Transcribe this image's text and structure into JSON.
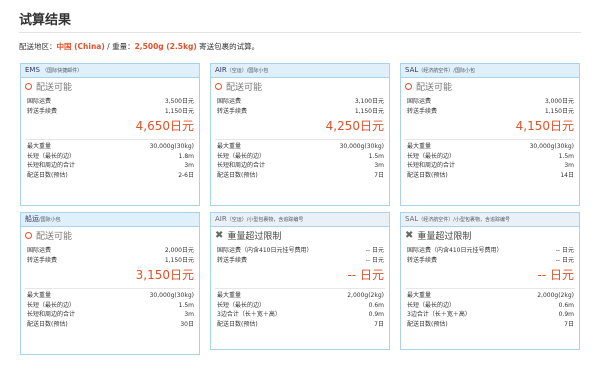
{
  "page_title": "试算结果",
  "summary": {
    "prefix": "配送地区：",
    "region": "中国 (China)",
    "sep": " / 重量：",
    "weight": "2,500g (2.5kg)",
    "suffix": " 寄送包裹的试算。"
  },
  "cards": [
    {
      "head_main": "EMS",
      "head_sub": "（国际快捷邮件）",
      "status": "配送可能",
      "fee1_label": "国际运费",
      "fee1_value": "3,500日元",
      "fee2_label": "转送手续费",
      "fee2_value": "1,150日元",
      "total": "4,650日元",
      "d1_label": "最大重量",
      "d1_value": "30,000g(30kg)",
      "d2_label": "长短（最长的边）",
      "d2_value": "1.8m",
      "d3_label": "长短和周边的合计",
      "d3_value": "3m",
      "d4_label": "配送日数(预估)",
      "d4_value": "2-6日"
    },
    {
      "head_main": "AIR",
      "head_sub": "（空运）/国际小包",
      "status": "配送可能",
      "fee1_label": "国际运费",
      "fee1_value": "3,100日元",
      "fee2_label": "转送手续费",
      "fee2_value": "1,150日元",
      "total": "4,250日元",
      "d1_label": "最大重量",
      "d1_value": "30,000g(30kg)",
      "d2_label": "长短（最长的边）",
      "d2_value": "1.5m",
      "d3_label": "长短和周边的合计",
      "d3_value": "3m",
      "d4_label": "配送日数(预估)",
      "d4_value": "7日"
    },
    {
      "head_main": "SAL",
      "head_sub": "（经济航空件）/国际小包",
      "status": "配送可能",
      "fee1_label": "国际运费",
      "fee1_value": "3,000日元",
      "fee2_label": "转送手续费",
      "fee2_value": "1,150日元",
      "total": "4,150日元",
      "d1_label": "最大重量",
      "d1_value": "30,000g(30kg)",
      "d2_label": "长短（最长的边）",
      "d2_value": "1.5m",
      "d3_label": "长短和周边的合计",
      "d3_value": "3m",
      "d4_label": "配送日数(预估)",
      "d4_value": "14日"
    },
    {
      "head_main": "船运",
      "head_sub": "/国际小包",
      "status": "配送可能",
      "fee1_label": "国际运费",
      "fee1_value": "2,000日元",
      "fee2_label": "转送手续费",
      "fee2_value": "1,150日元",
      "total": "3,150日元",
      "d1_label": "最大重量",
      "d1_value": "30,000g(30kg)",
      "d2_label": "长短（最长的边）",
      "d2_value": "1.5m",
      "d3_label": "长短和周边的合计",
      "d3_value": "3m",
      "d4_label": "配送日数(预估)",
      "d4_value": "30日"
    },
    {
      "head_main": "AIR",
      "head_sub": "（空运）/小型包裹物，含追踪编号",
      "status": "重量超过限制",
      "fee1_label": "国际运费（内含410日元挂号费用）",
      "fee1_value": "-- 日元",
      "fee2_label": "转送手续费",
      "fee2_value": "-- 日元",
      "total": "-- 日元",
      "d1_label": "最大重量",
      "d1_value": "2,000g(2kg)",
      "d2_label": "长短（最长的边）",
      "d2_value": "0.6m",
      "d3_label": "3边合计（长＋宽＋高）",
      "d3_value": "0.9m",
      "d4_label": "配送日数(预估)",
      "d4_value": "7日"
    },
    {
      "head_main": "SAL",
      "head_sub": "（经济航空件）/小型包裹物，含追踪编号",
      "status": "重量超过限制",
      "fee1_label": "国际运费（内含410日元挂号费用）",
      "fee1_value": "-- 日元",
      "fee2_label": "转送手续费",
      "fee2_value": "-- 日元",
      "total": "-- 日元",
      "d1_label": "最大重量",
      "d1_value": "2,000g(2kg)",
      "d2_label": "长短（最长的边）",
      "d2_value": "0.6m",
      "d3_label": "3边合计（长＋宽＋高）",
      "d3_value": "0.9m",
      "d4_label": "配送日数(预估)",
      "d4_value": "7日"
    }
  ]
}
